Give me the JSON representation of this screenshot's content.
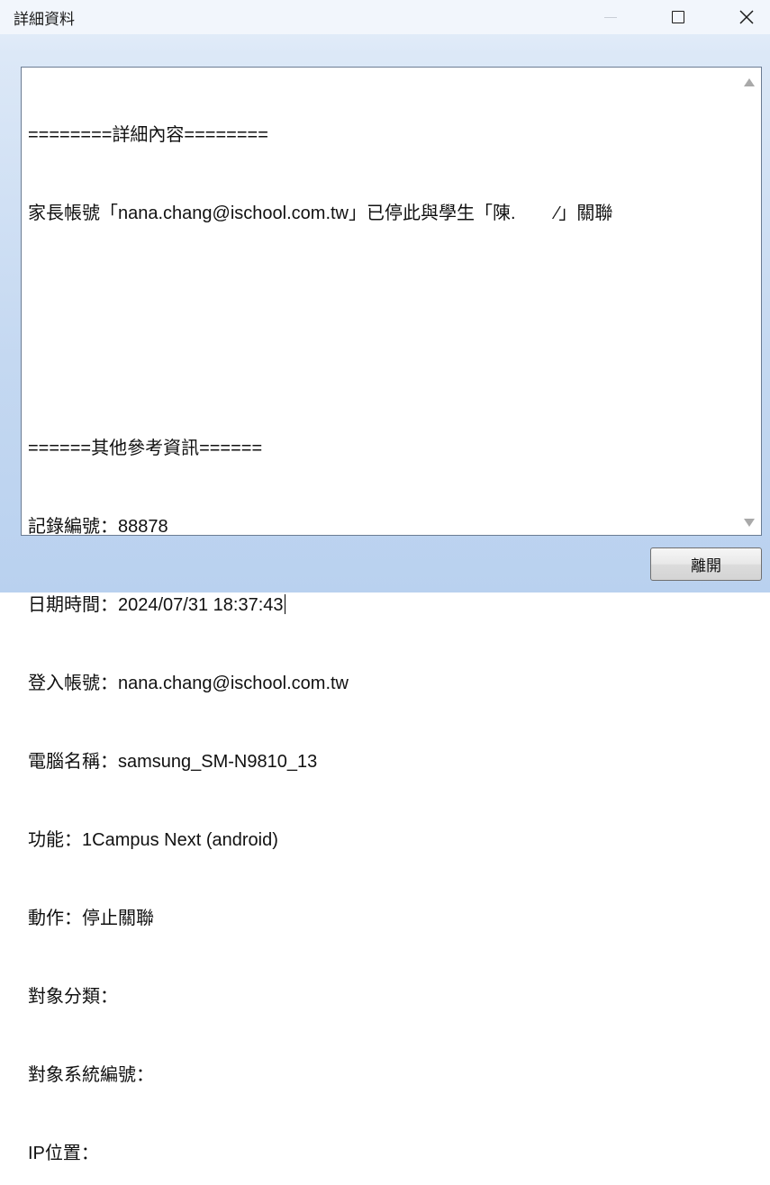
{
  "window": {
    "title": "詳細資料"
  },
  "details": {
    "lines": [
      "========詳細內容========",
      "家長帳號「nana.chang@ischool.com.tw」已停此與學生「陳.        ⁄」關聯",
      "",
      "",
      "======其他參考資訊======",
      "記錄編號：88878",
      "日期時間：2024/07/31 18:37:43",
      "登入帳號：nana.chang@ischool.com.tw",
      "電腦名稱：samsung_SM-N9810_13",
      "功能：1Campus Next (android)",
      "動作：停止關聯",
      "對象分類：",
      "對象系統編號：",
      "IP位置："
    ]
  },
  "buttons": {
    "leave_label": "離開"
  },
  "icons": {
    "minimize": "minimize-icon",
    "maximize": "maximize-icon",
    "close": "close-icon",
    "scroll_up": "scroll-up-arrow-icon",
    "scroll_down": "scroll-down-arrow-icon"
  }
}
